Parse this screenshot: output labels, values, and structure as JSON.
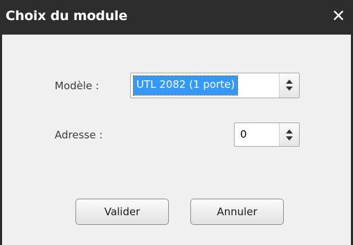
{
  "window": {
    "title": "Choix du module",
    "close_glyph": "✕"
  },
  "form": {
    "model_label": "Modèle :",
    "model_value": "UTL 2082 (1 porte)",
    "address_label": "Adresse :",
    "address_value": "0"
  },
  "buttons": {
    "ok_label": "Valider",
    "cancel_label": "Annuler"
  },
  "colors": {
    "titlebar": "#2d2d2d",
    "selection": "#3399ff",
    "background": "#f0f0f0"
  },
  "icons": {
    "close": "close-icon",
    "spin_up": "chevron-up-icon",
    "spin_down": "chevron-down-icon"
  }
}
